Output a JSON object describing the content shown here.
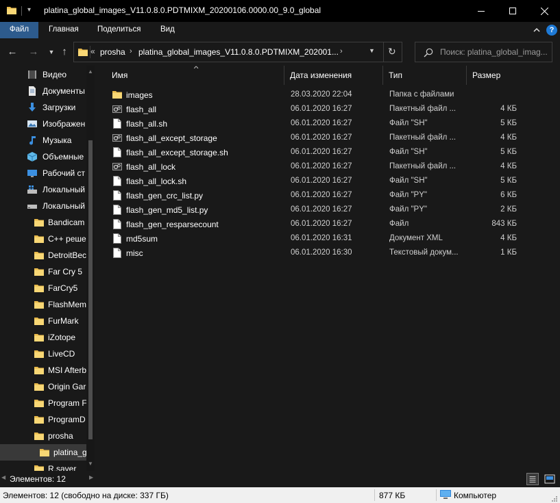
{
  "window": {
    "title": "platina_global_images_V11.0.8.0.PDTMIXM_20200106.0000.00_9.0_global"
  },
  "ribbon": {
    "tabs": [
      "Файл",
      "Главная",
      "Поделиться",
      "Вид"
    ]
  },
  "address": {
    "overflow": "«",
    "segments": [
      "prosha",
      "platina_global_images_V11.0.8.0.PDTMIXM_202001..."
    ]
  },
  "search": {
    "placeholder": "Поиск: platina_global_imag..."
  },
  "sidebar": {
    "items": [
      {
        "label": "Видео",
        "icon": "video-icon"
      },
      {
        "label": "Документы",
        "icon": "documents-icon"
      },
      {
        "label": "Загрузки",
        "icon": "downloads-icon"
      },
      {
        "label": "Изображен",
        "icon": "pictures-icon"
      },
      {
        "label": "Музыка",
        "icon": "music-icon"
      },
      {
        "label": "Объемные",
        "icon": "3d-objects-icon"
      },
      {
        "label": "Рабочий ст",
        "icon": "desktop-icon"
      },
      {
        "label": "Локальный",
        "icon": "windows-drive-icon"
      },
      {
        "label": "Локальный",
        "icon": "drive-icon"
      },
      {
        "label": "Bandicam",
        "icon": "folder-icon"
      },
      {
        "label": "C++ реше",
        "icon": "folder-icon"
      },
      {
        "label": "DetroitBec",
        "icon": "folder-icon"
      },
      {
        "label": "Far Cry 5",
        "icon": "folder-icon"
      },
      {
        "label": "FarCry5",
        "icon": "folder-icon"
      },
      {
        "label": "FlashMem",
        "icon": "folder-icon"
      },
      {
        "label": "FurMark",
        "icon": "folder-icon"
      },
      {
        "label": "iZotope",
        "icon": "folder-icon"
      },
      {
        "label": "LiveCD",
        "icon": "folder-icon"
      },
      {
        "label": "MSI Afterb",
        "icon": "folder-icon"
      },
      {
        "label": "Origin Gar",
        "icon": "folder-icon"
      },
      {
        "label": "Program F",
        "icon": "folder-icon"
      },
      {
        "label": "ProgramD",
        "icon": "folder-icon"
      },
      {
        "label": "prosha",
        "icon": "folder-icon"
      },
      {
        "label": "platina_g",
        "icon": "folder-icon"
      },
      {
        "label": "R.saver",
        "icon": "folder-icon"
      }
    ]
  },
  "columns": {
    "name": "Имя",
    "date": "Дата изменения",
    "type": "Тип",
    "size": "Размер"
  },
  "files": [
    {
      "name": "images",
      "date": "28.03.2020 22:04",
      "type": "Папка с файлами",
      "size": "",
      "icon": "folder-icon"
    },
    {
      "name": "flash_all",
      "date": "06.01.2020 16:27",
      "type": "Пакетный файл ...",
      "size": "4 КБ",
      "icon": "batch-file-icon"
    },
    {
      "name": "flash_all.sh",
      "date": "06.01.2020 16:27",
      "type": "Файл \"SH\"",
      "size": "5 КБ",
      "icon": "file-icon"
    },
    {
      "name": "flash_all_except_storage",
      "date": "06.01.2020 16:27",
      "type": "Пакетный файл ...",
      "size": "4 КБ",
      "icon": "batch-file-icon"
    },
    {
      "name": "flash_all_except_storage.sh",
      "date": "06.01.2020 16:27",
      "type": "Файл \"SH\"",
      "size": "5 КБ",
      "icon": "file-icon"
    },
    {
      "name": "flash_all_lock",
      "date": "06.01.2020 16:27",
      "type": "Пакетный файл ...",
      "size": "4 КБ",
      "icon": "batch-file-icon"
    },
    {
      "name": "flash_all_lock.sh",
      "date": "06.01.2020 16:27",
      "type": "Файл \"SH\"",
      "size": "5 КБ",
      "icon": "file-icon"
    },
    {
      "name": "flash_gen_crc_list.py",
      "date": "06.01.2020 16:27",
      "type": "Файл \"PY\"",
      "size": "6 КБ",
      "icon": "file-icon"
    },
    {
      "name": "flash_gen_md5_list.py",
      "date": "06.01.2020 16:27",
      "type": "Файл \"PY\"",
      "size": "2 КБ",
      "icon": "file-icon"
    },
    {
      "name": "flash_gen_resparsecount",
      "date": "06.01.2020 16:27",
      "type": "Файл",
      "size": "843 КБ",
      "icon": "file-icon"
    },
    {
      "name": "md5sum",
      "date": "06.01.2020 16:31",
      "type": "Документ XML",
      "size": "4 КБ",
      "icon": "file-icon"
    },
    {
      "name": "misc",
      "date": "06.01.2020 16:30",
      "type": "Текстовый докум...",
      "size": "1 КБ",
      "icon": "file-icon"
    }
  ],
  "bottom": {
    "items_label": "Элементов: 12"
  },
  "status": {
    "left": "Элементов: 12 (свободно на диске: 337 ГБ)",
    "size": "877 КБ",
    "location": "Компьютер"
  },
  "colors": {
    "accent": "#2d5b8d",
    "folder": "#f8d775",
    "background": "#191919"
  }
}
